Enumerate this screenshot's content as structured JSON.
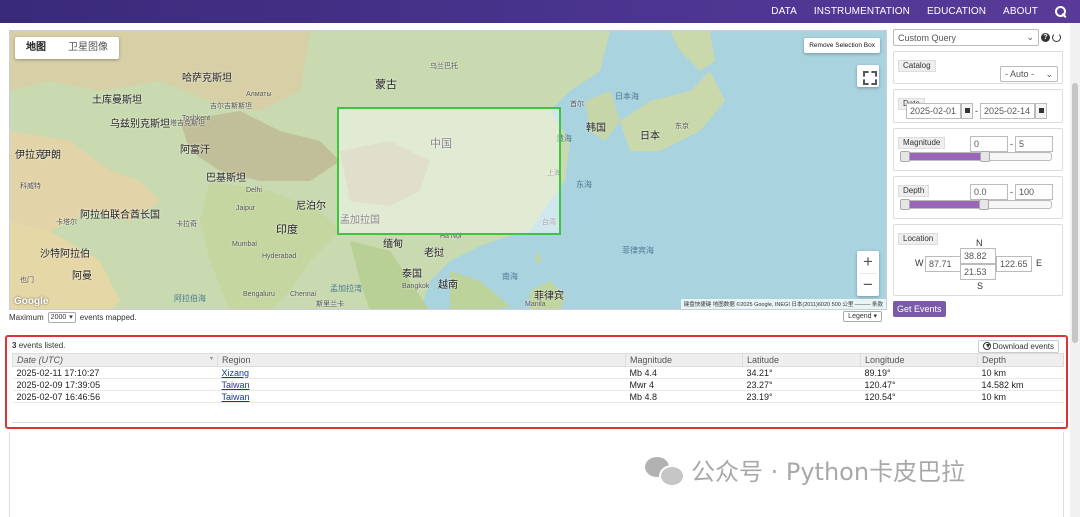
{
  "nav": {
    "links": [
      "DATA",
      "INSTRUMENTATION",
      "EDUCATION",
      "ABOUT"
    ],
    "search_icon": "search-icon"
  },
  "map": {
    "type_buttons": [
      "地图",
      "卫星图像"
    ],
    "remove_selection_label": "Remove Selection Box",
    "zoom_in": "+",
    "zoom_out": "−",
    "google": "Google",
    "attribution": "键盘快捷键  地图数据 ©2025 Google, INEGI 日本(2011)6020  500 公里 ────  条款",
    "labels": {
      "kazakhstan": "哈萨克斯坦",
      "mongolia": "蒙古",
      "china": "中国",
      "india": "印度",
      "iran": "伊朗",
      "pakistan": "巴基斯坦",
      "afghanistan": "阿富汗",
      "turkmenistan": "土库曼斯坦",
      "uzbekistan": "乌兹别克斯坦",
      "kyrgyzstan": "吉尔吉斯斯坦",
      "tajikistan": "塔吉克斯坦",
      "saudi": "沙特阿拉伯",
      "iraq": "伊拉克",
      "oman": "阿曼",
      "uae": "阿拉伯联合酋长国",
      "nepal": "尼泊尔",
      "bangladesh": "孟加拉国",
      "myanmar": "缅甸",
      "thailand": "泰国",
      "laos": "老挝",
      "vietnam": "越南",
      "korea": "韩国",
      "japan": "日本",
      "philippines": "菲律宾",
      "tokyo": "东京",
      "seoul": "首尔",
      "shanghai": "上海",
      "taiwan": "台湾",
      "hanoi": "Hà Nội",
      "bangkok": "Bangkok",
      "manila": "Manila",
      "delhi": "Delhi",
      "mumbai": "Mumbai",
      "hyderabad": "Hyderabad",
      "bengaluru": "Bengaluru",
      "chennai": "Chennai",
      "jaipur": "Jaipur",
      "karachi": "卡拉奇",
      "tashkent": "Toshkent",
      "almaty": "Алматы",
      "ulaanbaatar": "乌兰巴托",
      "sea_of_japan": "日本海",
      "yellow_sea": "黄海",
      "east_china_sea": "东海",
      "south_china_sea": "南海",
      "philippine_sea": "菲律宾海",
      "arabian_sea": "阿拉伯海",
      "bay_of_bengal": "孟加拉湾",
      "sri_lanka": "斯里兰卡",
      "kuwait": "科威特",
      "yemen": "也门",
      "qatar": "卡塔尔"
    }
  },
  "below_map": {
    "prefix": "Maximum",
    "max_value": "2000",
    "suffix": "events mapped.",
    "legend_label": "Legend"
  },
  "panel": {
    "query_select": "Custom Query",
    "catalog": {
      "title": "Catalog",
      "value": "- Auto -"
    },
    "date": {
      "title": "Date",
      "start": "2025-02-01",
      "end": "2025-02-14"
    },
    "magnitude": {
      "title": "Magnitude",
      "min": "0",
      "max": "5",
      "range_min": 0,
      "range_max": 9,
      "fill_fraction": 0.56
    },
    "depth": {
      "title": "Depth",
      "min": "0.0",
      "max": "100",
      "fill_fraction": 0.55
    },
    "location": {
      "title": "Location",
      "n_label": "N",
      "s_label": "S",
      "w_label": "W",
      "e_label": "E",
      "north": "38.82",
      "south": "21.53",
      "west": "87.71",
      "east": "122.65"
    },
    "get_events_label": "Get Events"
  },
  "events": {
    "count": "3",
    "count_suffix": "events listed.",
    "download_label": "Download events",
    "columns": [
      "Date (UTC)",
      "Region",
      "Magnitude",
      "Latitude",
      "Longitude",
      "Depth"
    ],
    "rows": [
      {
        "date": "2025-02-11 17:10:27",
        "region": "Xizang",
        "magnitude": "Mb 4.4",
        "latitude": "34.21°",
        "longitude": "89.19°",
        "depth": "10 km"
      },
      {
        "date": "2025-02-09 17:39:05",
        "region": "Taiwan",
        "magnitude": "Mwr 4",
        "latitude": "23.27°",
        "longitude": "120.47°",
        "depth": "14.582 km"
      },
      {
        "date": "2025-02-07 16:46:56",
        "region": "Taiwan",
        "magnitude": "Mb 4.8",
        "latitude": "23.19°",
        "longitude": "120.54°",
        "depth": "10 km"
      }
    ]
  },
  "watermark": {
    "text": "公众号 · Python卡皮巴拉"
  },
  "colors": {
    "nav": "#3a2a7a",
    "accent": "#7a5ba8",
    "selection": "#3fc43f",
    "highlight": "#dd3333"
  }
}
